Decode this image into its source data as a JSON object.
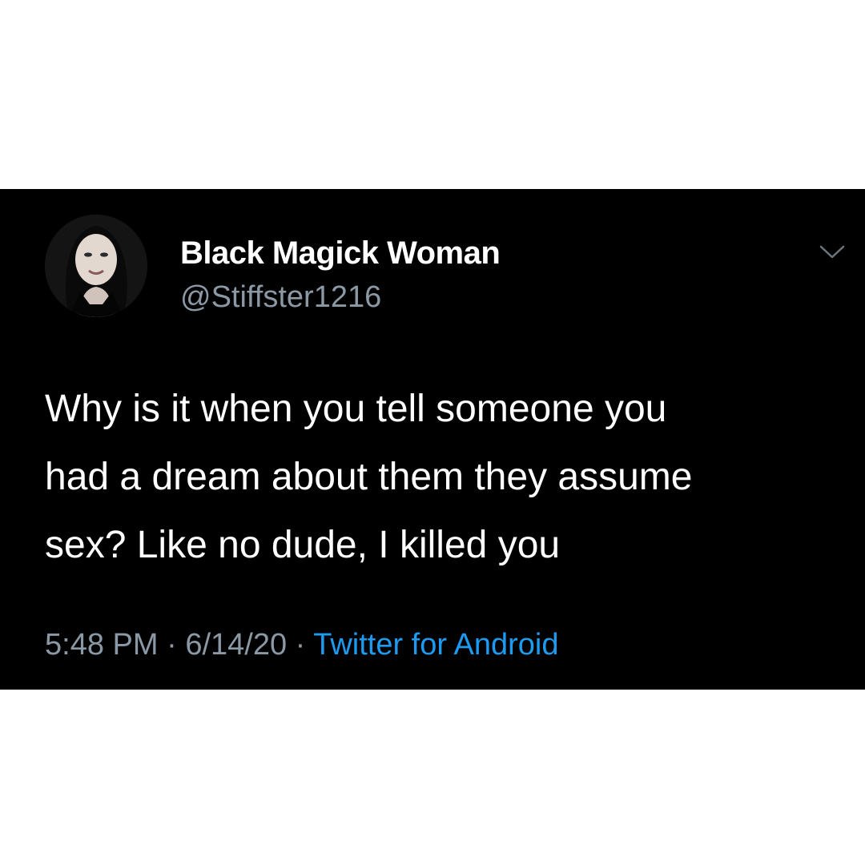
{
  "author": {
    "display_name": "Black Magick Woman",
    "handle": "@Stiffster1216"
  },
  "tweet": {
    "lines": [
      "Why is it when you tell someone you",
      "had a dream about them they assume",
      "sex? Like no dude, I killed you"
    ]
  },
  "meta": {
    "time": "5:48 PM",
    "separator": "·",
    "date": "6/14/20",
    "source": "Twitter for Android"
  },
  "icons": {
    "more_menu": "chevron-down-icon",
    "avatar": "avatar-photo"
  },
  "colors": {
    "background": "#000000",
    "text": "#ffffff",
    "secondary_text": "#8b98a5",
    "link": "#1d9bf0"
  }
}
